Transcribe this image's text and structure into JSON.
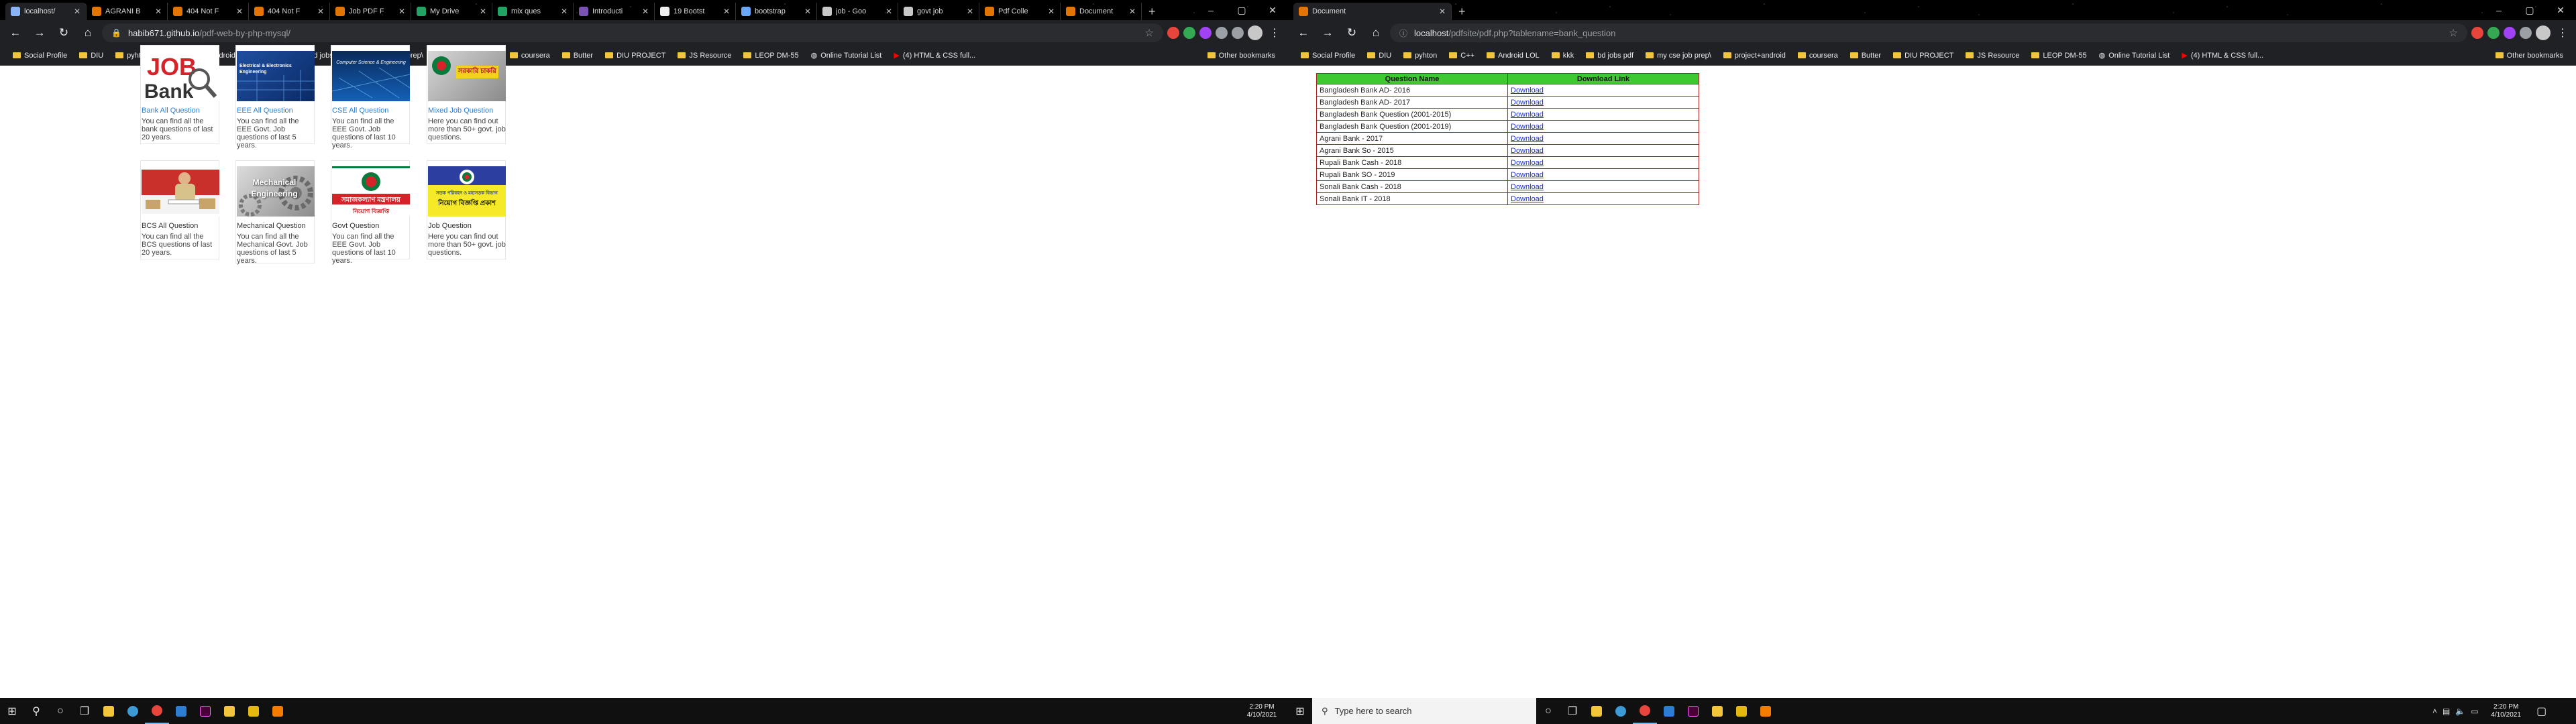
{
  "left_window": {
    "tabs": [
      {
        "label": "localhost/",
        "color": "#8ab4f8"
      },
      {
        "label": "AGRANI B",
        "color": "#e37400"
      },
      {
        "label": "404 Not F",
        "color": "#e37400"
      },
      {
        "label": "404 Not F",
        "color": "#e37400"
      },
      {
        "label": "Job PDF F",
        "color": "#e37400"
      },
      {
        "label": "My Drive",
        "color": "#1fa463"
      },
      {
        "label": "mix ques",
        "color": "#1fa463"
      },
      {
        "label": "Introducti",
        "color": "#7952b3"
      },
      {
        "label": "19 Bootst",
        "color": "#eeeeee"
      },
      {
        "label": "bootstrap",
        "color": "#6aa7f8"
      },
      {
        "label": "job - Goo",
        "color": "#c8c8c8"
      },
      {
        "label": "govt job",
        "color": "#c8c8c8"
      },
      {
        "label": "Pdf Colle",
        "color": "#e37400"
      },
      {
        "label": "Document",
        "color": "#e37400"
      }
    ],
    "url_host": "habib671.github.io",
    "url_path": "/pdf-web-by-php-mysql/",
    "cards_row1": [
      {
        "title": "Bank All Question",
        "desc": "You can find all the bank questions of last 20 years.",
        "thumb": "job-bank"
      },
      {
        "title": "EEE All Question",
        "desc": "You can find all the EEE Govt. Job questions of last 5 years.",
        "thumb": "eee",
        "thumb_text": "Electrical & Electronics Engineering"
      },
      {
        "title": "CSE All Question",
        "desc": "You can find all the EEE Govt. Job questions of last 10 years.",
        "thumb": "cse",
        "thumb_text": "Computer Science & Engineering"
      },
      {
        "title": "Mixed Job Question",
        "desc": "Here you can find out more than 50+ govt. job questions.",
        "thumb": "mixed",
        "thumb_text": "সরকারি চাকরি"
      }
    ],
    "cards_row2": [
      {
        "title": "BCS All Question",
        "desc": "You can find all the BCS questions of last 20 years.",
        "thumb": "bcs"
      },
      {
        "title": "Mechanical Question",
        "desc": "You can find all the Mechanical Govt. Job questions of last 5 years.",
        "thumb": "mech",
        "thumb_text": "Mechanical Engineering"
      },
      {
        "title": "Govt Question",
        "desc": "You can find all the EEE Govt. Job questions of last 10 years.",
        "thumb": "govt",
        "thumb_text": "সমাজকল্যাণ মন্ত্রণালয়",
        "thumb_sub": "নিয়োগ বিজ্ঞপ্তি"
      },
      {
        "title": "Job Question",
        "desc": "Here you can find out more than 50+ govt. job questions.",
        "thumb": "jobq",
        "thumb_text": "সড়ক পরিবহন ও মহাসড়ক বিভাগ",
        "thumb_sub": "নিয়োগ বিজ্ঞপ্তি প্রকাশ"
      }
    ],
    "job_logo": "JOB",
    "bank_logo": "Bank"
  },
  "right_window": {
    "tabs": [
      {
        "label": "Document",
        "color": "#e37400"
      }
    ],
    "url_host": "localhost",
    "url_path": "/pdfsite/pdf.php?tablename=bank_question",
    "table": {
      "headers": [
        "Question Name",
        "Download Link"
      ],
      "link_label": "Download",
      "rows": [
        "Bangladesh Bank AD- 2016",
        "Bangladesh Bank AD- 2017",
        "Bangladesh Bank Question (2001-2015)",
        "Bangladesh Bank Question (2001-2019)",
        "Agrani Bank - 2017",
        "Agrani Bank So - 2015",
        "Rupali Bank Cash - 2018",
        "Rupali Bank SO - 2019",
        "Sonali Bank Cash - 2018",
        "Sonali Bank IT - 2018"
      ]
    }
  },
  "bookmarks": [
    {
      "label": "Social Profile",
      "icon": "folder"
    },
    {
      "label": "DIU",
      "icon": "folder"
    },
    {
      "label": "pyhton",
      "icon": "folder"
    },
    {
      "label": "C++",
      "icon": "folder"
    },
    {
      "label": "Android LOL",
      "icon": "folder"
    },
    {
      "label": "kkk",
      "icon": "folder"
    },
    {
      "label": "bd jobs pdf",
      "icon": "folder"
    },
    {
      "label": "my cse job prep\\",
      "icon": "folder"
    },
    {
      "label": "project+android",
      "icon": "folder"
    },
    {
      "label": "coursera",
      "icon": "folder"
    },
    {
      "label": "Butter",
      "icon": "folder"
    },
    {
      "label": "DIU PROJECT",
      "icon": "folder"
    },
    {
      "label": "JS Resource",
      "icon": "folder"
    },
    {
      "label": "LEOP DM-55",
      "icon": "folder"
    },
    {
      "label": "Online Tutorial List",
      "icon": "globe"
    },
    {
      "label": "(4) HTML & CSS full...",
      "icon": "youtube"
    }
  ],
  "other_bookmarks": "Other bookmarks",
  "taskbar": {
    "search_placeholder": "Type here to search",
    "time": "2:20 PM",
    "date": "4/10/2021"
  },
  "colors": {
    "link_blue": "#2b7fd3",
    "table_header_green": "#3fc832",
    "table_border_red": "#b02020"
  }
}
